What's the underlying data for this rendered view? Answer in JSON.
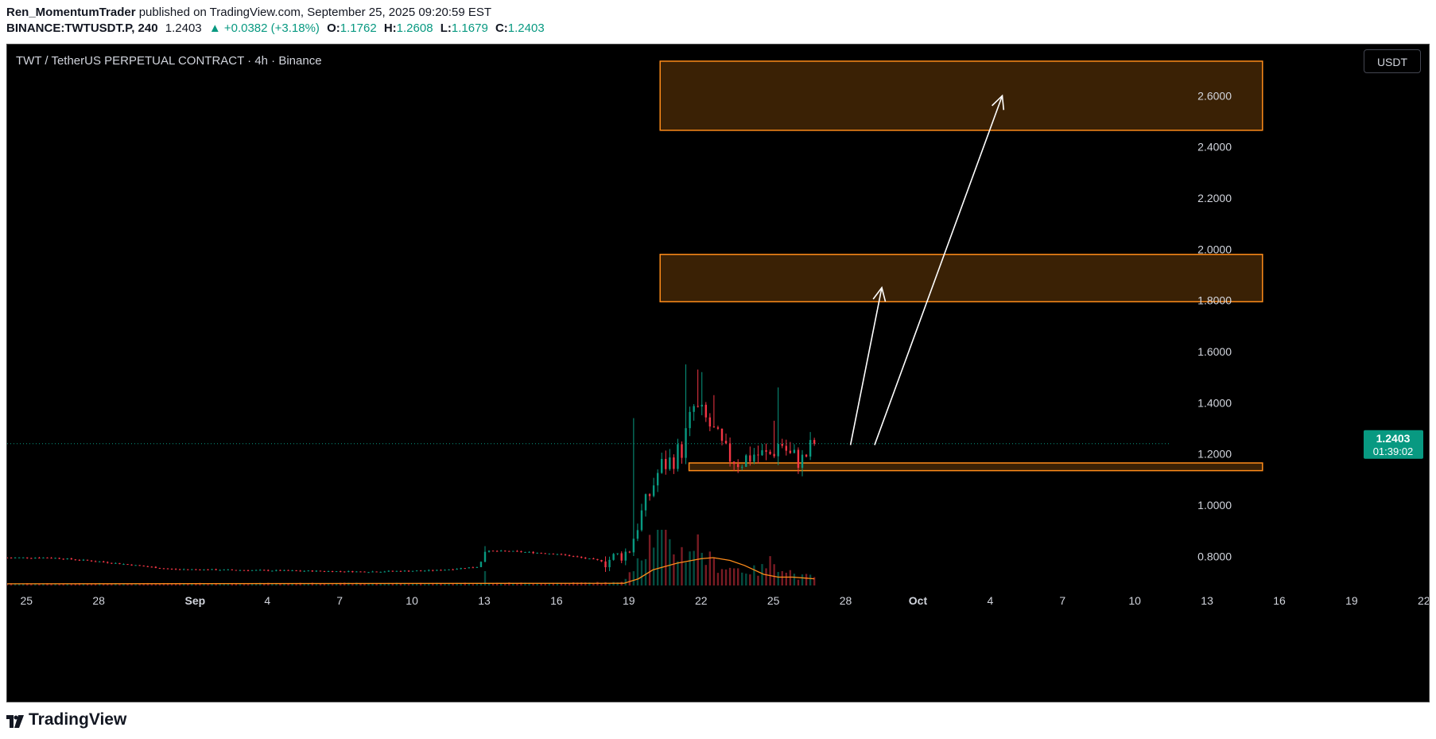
{
  "header": {
    "author": "Ren_MomentumTrader",
    "published_text": "published on TradingView.com, September 25, 2025 09:20:59 EST",
    "symbol": "BINANCE:TWTUSDT.P, 240",
    "last": "1.2403",
    "change": "▲ +0.0382 (+3.18%)",
    "o_label": "O:",
    "o_value": "1.1762",
    "h_label": "H:",
    "h_value": "1.2608",
    "l_label": "L:",
    "l_value": "1.1679",
    "c_label": "C:",
    "c_value": "1.2403"
  },
  "chart_title": "TWT / TetherUS PERPETUAL CONTRACT · 4h · Binance",
  "currency_button": "USDT",
  "price_tag": {
    "price": "1.2403",
    "countdown": "01:39:02"
  },
  "footer": {
    "brand": "TradingView"
  },
  "colors": {
    "up": "#089981",
    "down": "#f23645",
    "zone_fill": "#3a2105",
    "zone_border": "#ff8c1a",
    "volume_ma": "#ff8c1a",
    "background": "#000000"
  },
  "chart_data": {
    "type": "candlestick",
    "title": "TWT / TetherUS PERPETUAL CONTRACT · 4h · Binance",
    "ylim": [
      0.68,
      2.8
    ],
    "y_ticks": [
      "2.6000",
      "2.4000",
      "2.2000",
      "2.0000",
      "1.8000",
      "1.6000",
      "1.4000",
      "1.2000",
      "1.0000",
      "0.8000"
    ],
    "x_range_days": [
      -0.8,
      58.6
    ],
    "x_ticks": [
      {
        "label": "25",
        "day": 0
      },
      {
        "label": "28",
        "day": 3
      },
      {
        "label": "Sep",
        "day": 7
      },
      {
        "label": "4",
        "day": 10
      },
      {
        "label": "7",
        "day": 13
      },
      {
        "label": "10",
        "day": 16
      },
      {
        "label": "13",
        "day": 19
      },
      {
        "label": "16",
        "day": 22
      },
      {
        "label": "19",
        "day": 25
      },
      {
        "label": "22",
        "day": 28
      },
      {
        "label": "25",
        "day": 31
      },
      {
        "label": "28",
        "day": 34
      },
      {
        "label": "Oct",
        "day": 37
      },
      {
        "label": "4",
        "day": 40
      },
      {
        "label": "7",
        "day": 43
      },
      {
        "label": "10",
        "day": 46
      },
      {
        "label": "13",
        "day": 49
      },
      {
        "label": "16",
        "day": 52
      },
      {
        "label": "19",
        "day": 55
      },
      {
        "label": "22",
        "day": 58
      }
    ],
    "price_key_points": [
      {
        "day": -0.8,
        "price": 0.795
      },
      {
        "day": 1.0,
        "price": 0.795
      },
      {
        "day": 3.0,
        "price": 0.78
      },
      {
        "day": 6.0,
        "price": 0.75
      },
      {
        "day": 10.0,
        "price": 0.745
      },
      {
        "day": 14.0,
        "price": 0.74
      },
      {
        "day": 17.0,
        "price": 0.745
      },
      {
        "day": 18.8,
        "price": 0.76
      },
      {
        "day": 19.0,
        "price": 0.82
      },
      {
        "day": 20.0,
        "price": 0.82
      },
      {
        "day": 22.0,
        "price": 0.81
      },
      {
        "day": 23.0,
        "price": 0.795
      },
      {
        "day": 24.0,
        "price": 0.78
      },
      {
        "day": 25.0,
        "price": 0.82
      },
      {
        "day": 25.5,
        "price": 0.96
      },
      {
        "day": 25.9,
        "price": 1.05
      },
      {
        "day": 26.3,
        "price": 1.15
      },
      {
        "day": 26.7,
        "price": 1.17
      },
      {
        "day": 27.2,
        "price": 1.22
      },
      {
        "day": 27.7,
        "price": 1.38
      },
      {
        "day": 28.3,
        "price": 1.32
      },
      {
        "day": 29.0,
        "price": 1.2
      },
      {
        "day": 29.6,
        "price": 1.17
      },
      {
        "day": 30.2,
        "price": 1.2
      },
      {
        "day": 30.8,
        "price": 1.19
      },
      {
        "day": 31.3,
        "price": 1.25
      },
      {
        "day": 31.7,
        "price": 1.19
      },
      {
        "day": 32.2,
        "price": 1.175
      },
      {
        "day": 32.7,
        "price": 1.2403
      }
    ],
    "wick_spikes": [
      {
        "day": 19.0,
        "high": 0.84
      },
      {
        "day": 25.2,
        "high": 1.34
      },
      {
        "day": 27.4,
        "high": 1.55
      },
      {
        "day": 27.9,
        "high": 1.53
      },
      {
        "day": 28.0,
        "high": 1.52
      },
      {
        "day": 28.5,
        "high": 1.43
      },
      {
        "day": 31.1,
        "high": 1.33
      },
      {
        "day": 31.2,
        "high": 1.46
      }
    ],
    "volume_key_points": [
      {
        "day": -0.8,
        "vol": 0.03
      },
      {
        "day": 18.9,
        "vol": 0.04
      },
      {
        "day": 19.0,
        "vol": 0.26
      },
      {
        "day": 19.2,
        "vol": 0.04
      },
      {
        "day": 24.8,
        "vol": 0.05
      },
      {
        "day": 25.0,
        "vol": 0.3
      },
      {
        "day": 25.4,
        "vol": 0.55
      },
      {
        "day": 25.8,
        "vol": 0.78
      },
      {
        "day": 26.2,
        "vol": 1.0
      },
      {
        "day": 26.6,
        "vol": 0.72
      },
      {
        "day": 27.0,
        "vol": 0.6
      },
      {
        "day": 27.4,
        "vol": 0.58
      },
      {
        "day": 27.8,
        "vol": 0.8
      },
      {
        "day": 28.2,
        "vol": 0.5
      },
      {
        "day": 28.6,
        "vol": 0.38
      },
      {
        "day": 29.2,
        "vol": 0.32
      },
      {
        "day": 29.8,
        "vol": 0.28
      },
      {
        "day": 30.4,
        "vol": 0.25
      },
      {
        "day": 31.0,
        "vol": 0.45
      },
      {
        "day": 31.4,
        "vol": 0.35
      },
      {
        "day": 32.0,
        "vol": 0.15
      },
      {
        "day": 32.7,
        "vol": 0.16
      }
    ],
    "volume_ma_points": [
      {
        "day": -0.8,
        "vol": 0.03
      },
      {
        "day": 24.8,
        "vol": 0.04
      },
      {
        "day": 25.4,
        "vol": 0.12
      },
      {
        "day": 26.0,
        "vol": 0.28
      },
      {
        "day": 27.0,
        "vol": 0.4
      },
      {
        "day": 28.0,
        "vol": 0.48
      },
      {
        "day": 28.5,
        "vol": 0.5
      },
      {
        "day": 29.2,
        "vol": 0.45
      },
      {
        "day": 29.8,
        "vol": 0.36
      },
      {
        "day": 30.6,
        "vol": 0.2
      },
      {
        "day": 31.2,
        "vol": 0.15
      },
      {
        "day": 31.8,
        "vol": 0.15
      },
      {
        "day": 32.7,
        "vol": 0.12
      }
    ],
    "zones": [
      {
        "day_start": 26.3,
        "day_end": 51.3,
        "price_low": 2.465,
        "price_high": 2.735
      },
      {
        "day_start": 26.3,
        "day_end": 51.3,
        "price_low": 1.795,
        "price_high": 1.98
      },
      {
        "day_start": 27.5,
        "day_end": 51.3,
        "price_low": 1.135,
        "price_high": 1.165
      }
    ],
    "arrows": [
      {
        "from_day": 34.2,
        "from_price": 1.235,
        "to_day": 35.5,
        "to_price": 1.85
      },
      {
        "from_day": 35.2,
        "from_price": 1.235,
        "to_day": 40.5,
        "to_price": 2.6
      }
    ],
    "last_price": 1.2403
  }
}
